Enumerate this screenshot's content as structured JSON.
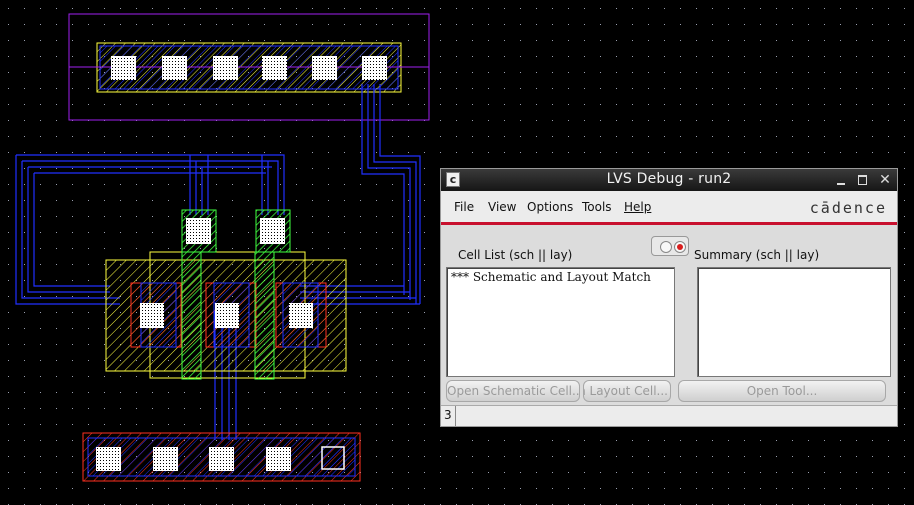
{
  "layout_canvas": {
    "background": "#000000",
    "grid_dot_color": "#9aa0b0",
    "colors": {
      "metal1": "#2030ff",
      "poly": "#ff2020",
      "diffusion": "#ffff40",
      "via": "#2ecc40",
      "well": "#a020f0",
      "contact": "#ffffff"
    }
  },
  "window": {
    "title": "LVS Debug - run2",
    "icon": "cadence-c-icon",
    "controls": [
      "minimize-icon",
      "maximize-icon",
      "close-icon"
    ]
  },
  "menu": {
    "items": [
      "File",
      "View",
      "Options",
      "Tools",
      "Help"
    ],
    "logo": "cādence",
    "accent": "#c8102e"
  },
  "panes": {
    "cell_list_label": "Cell List (sch || lay)",
    "summary_label": "Summary (sch || lay)",
    "cell_list_rows": [
      "*** Schematic and Layout Match"
    ]
  },
  "buttons": {
    "open_schematic": "Open Schematic Cell...",
    "open_layout": "Open Layout Cell...",
    "open_tool": "Open Tool..."
  },
  "status": {
    "count": "3"
  }
}
